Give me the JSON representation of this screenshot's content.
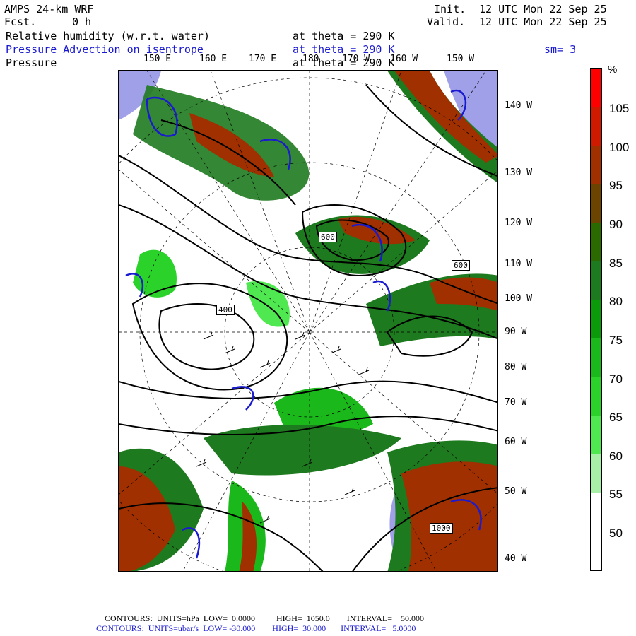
{
  "header": {
    "model": "AMPS 24-km WRF",
    "forecast_label": "Fcst.",
    "forecast_value": "0 h",
    "init_label": "Init.",
    "init_value": "12 UTC Mon 22 Sep 25",
    "valid_label": "Valid.",
    "valid_value": "12 UTC Mon 22 Sep 25"
  },
  "fields": [
    {
      "name": "Relative humidity (w.r.t. water)",
      "level": "at theta = 290 K",
      "color": "#000000"
    },
    {
      "name": "Pressure Advection on isentrope",
      "level": "at theta = 290 K",
      "color": "#1a1ad0",
      "smooth": "sm= 3"
    },
    {
      "name": "Pressure",
      "level": "at theta = 290 K",
      "color": "#000000"
    }
  ],
  "longitude_labels": [
    "150 E",
    "160 E",
    "170 E",
    "180",
    "170 W",
    "160 W",
    "150 W"
  ],
  "latitude_labels": [
    "140 W",
    "130 W",
    "120 W",
    "110 W",
    "100 W",
    "90 W",
    "80 W",
    "70 W",
    "60 W",
    "50 W",
    "40 W"
  ],
  "contour_labels": [
    "600",
    "600",
    "400",
    "1000"
  ],
  "colorbar": {
    "unit": "%",
    "labels": [
      "105",
      "100",
      "95",
      "90",
      "85",
      "80",
      "75",
      "70",
      "65",
      "60",
      "55",
      "50"
    ],
    "colors": [
      "#ff0000",
      "#d01a00",
      "#a03000",
      "#6a4400",
      "#2a6a00",
      "#1e7a1e",
      "#0a9a0a",
      "#1ab81a",
      "#2ad22a",
      "#50e850",
      "#a8f0a8",
      "#ffffff",
      "#ffffff"
    ]
  },
  "footer": {
    "line1": "CONTOURS:  UNITS=hPa  LOW=  0.0000          HIGH=  1050.0        INTERVAL=    50.000",
    "line2": "CONTOURS:  UNITS=ubar/s  LOW= -30.000        HIGH=  30.000       INTERVAL=   5.0000"
  }
}
